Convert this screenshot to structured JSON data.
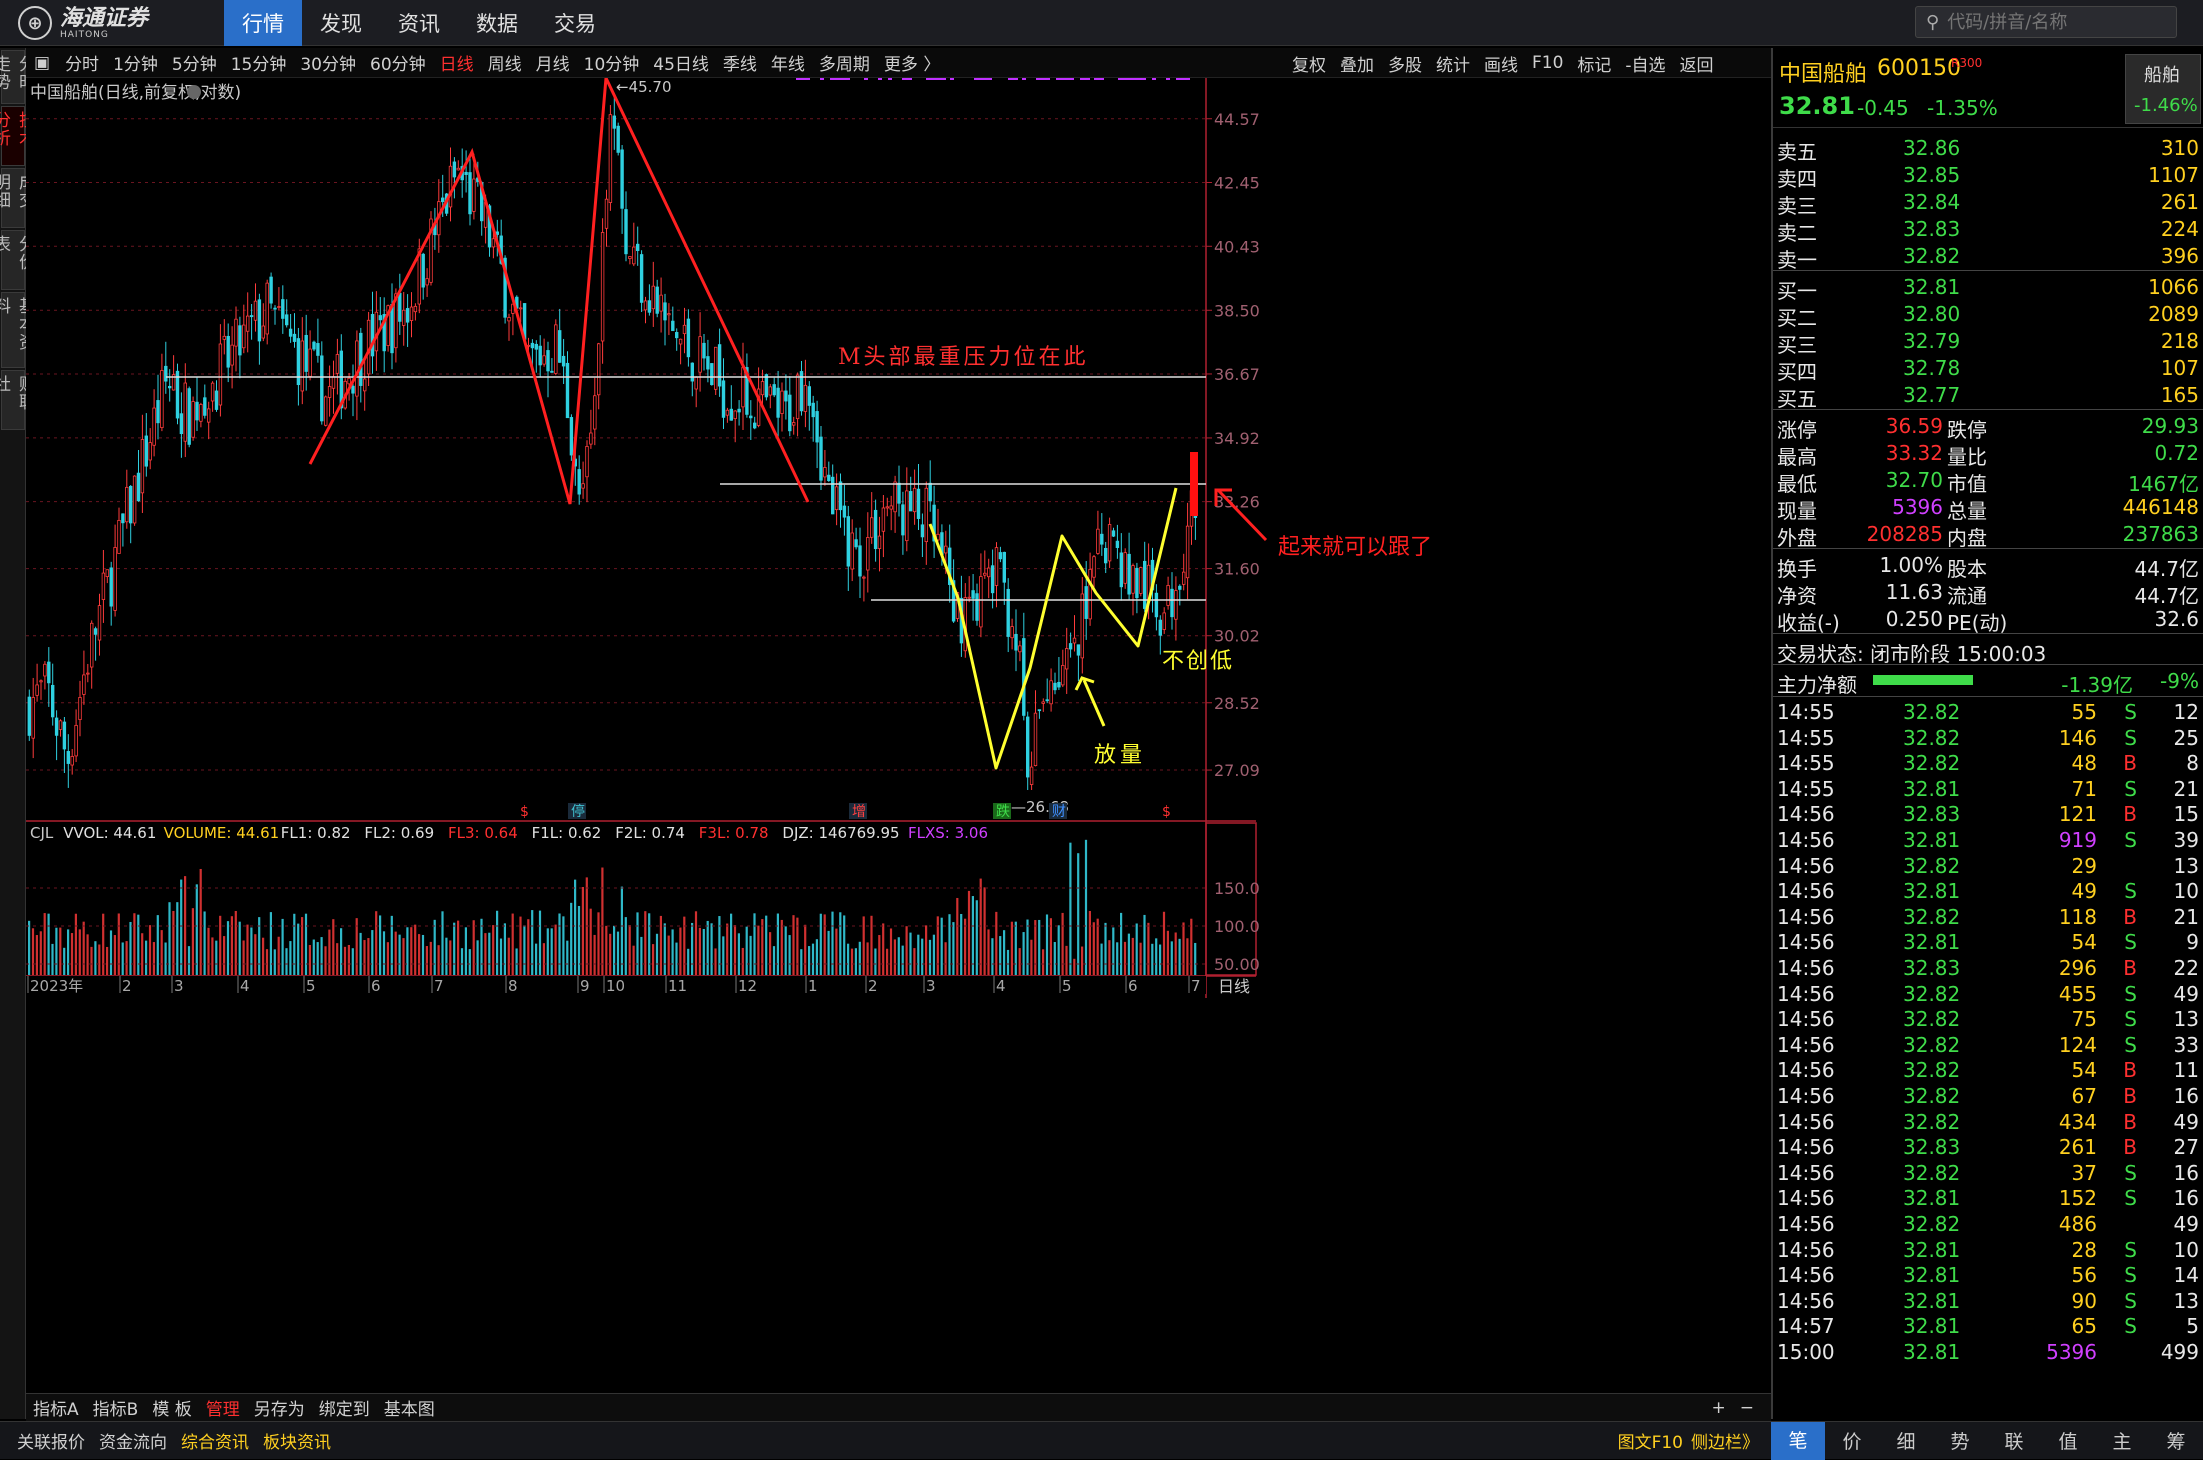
{
  "header": {
    "logo_cn": "海通证券",
    "logo_en": "HAITONG",
    "nav": [
      "行情",
      "发现",
      "资讯",
      "数据",
      "交易"
    ],
    "search_placeholder": "代码/拼音/名称"
  },
  "left_tabs": [
    "分时走势",
    "技术分析",
    "成交明细",
    "分价表",
    "基本资料",
    "财联社"
  ],
  "period_bar": [
    "分时",
    "1分钟",
    "5分钟",
    "15分钟",
    "30分钟",
    "60分钟",
    "日线",
    "周线",
    "月线",
    "10分钟",
    "45日线",
    "季线",
    "年线",
    "多周期",
    "更多 〉"
  ],
  "period_active": "日线",
  "right_tools": [
    "复权",
    "叠加",
    "多股",
    "统计",
    "画线",
    "F10",
    "标记",
    "-自选",
    "返回"
  ],
  "chart_label": "中国船舶(日线,前复权,对数)",
  "chart_data": {
    "type": "candlestick",
    "price_ticks": [
      "44.57",
      "42.45",
      "40.43",
      "38.50",
      "36.67",
      "34.92",
      "33.26",
      "31.60",
      "30.02",
      "28.52",
      "27.09"
    ],
    "max_label": "45.70",
    "min_label": "26.68",
    "xaxis": [
      "2023年",
      "2",
      "3",
      "4",
      "5",
      "6",
      "7",
      "8",
      "9",
      "10",
      "11",
      "12",
      "1",
      "2",
      "3",
      "4",
      "5",
      "6",
      "7"
    ],
    "event_markers": [
      "$",
      "停",
      "增",
      "跌",
      "财",
      "$"
    ],
    "volume_ticks": [
      "150.0",
      "100.0",
      "50.00"
    ],
    "volume_legend": [
      {
        "t": "CJL",
        "c": "#c8c8c8"
      },
      {
        "t": "VVOL: 44.61",
        "c": "#e0e0e0"
      },
      {
        "t": "VOLUME: 44.61",
        "c": "#ffd020"
      },
      {
        "t": "FL1: 0.82",
        "c": "#e0e0e0"
      },
      {
        "t": "FL2: 0.69",
        "c": "#e0e0e0"
      },
      {
        "t": "FL3: 0.64",
        "c": "#ff3030"
      },
      {
        "t": "F1L: 0.62",
        "c": "#e0e0e0"
      },
      {
        "t": "F2L: 0.74",
        "c": "#e0e0e0"
      },
      {
        "t": "F3L: 0.78",
        "c": "#ff3030"
      },
      {
        "t": "DJZ: 146769.95",
        "c": "#e0e0e0"
      },
      {
        "t": "FLXS: 3.06",
        "c": "#d040ff"
      }
    ],
    "period_label": "日线",
    "annotations": {
      "m_head": "M头部最重压力位在此",
      "volume_up": "放量",
      "no_new_low": "不创低",
      "chase": "起来就可以跟了"
    }
  },
  "bottom_bar": [
    "指标A",
    "指标B",
    "模 板",
    "管理",
    "另存为",
    "绑定到",
    "基本图"
  ],
  "status_bar": [
    "关联报价",
    "资金流向",
    "综合资讯",
    "板块资讯"
  ],
  "status_right": [
    "图文F10",
    "侧边栏》"
  ],
  "quote": {
    "name": "中国船舶",
    "code": "600150",
    "badge": "R300",
    "sector": "船舶",
    "sector_pct": "-1.46%",
    "price": "32.81",
    "change": "-0.45",
    "pct": "-1.35%",
    "asks": [
      [
        "卖五",
        "32.86",
        "310"
      ],
      [
        "卖四",
        "32.85",
        "1107"
      ],
      [
        "卖三",
        "32.84",
        "261"
      ],
      [
        "卖二",
        "32.83",
        "224"
      ],
      [
        "卖一",
        "32.82",
        "396"
      ]
    ],
    "bids": [
      [
        "买一",
        "32.81",
        "1066"
      ],
      [
        "买二",
        "32.80",
        "2089"
      ],
      [
        "买三",
        "32.79",
        "218"
      ],
      [
        "买四",
        "32.78",
        "107"
      ],
      [
        "买五",
        "32.77",
        "165"
      ]
    ],
    "stats": [
      [
        "涨停",
        "36.59",
        "跌停",
        "29.93"
      ],
      [
        "最高",
        "33.32",
        "量比",
        "0.72"
      ],
      [
        "最低",
        "32.70",
        "市值",
        "1467亿"
      ],
      [
        "现量",
        "5396",
        "总量",
        "446148"
      ],
      [
        "外盘",
        "208285",
        "内盘",
        "237863"
      ]
    ],
    "fund": [
      [
        "换手",
        "1.00%",
        "股本",
        "44.7亿"
      ],
      [
        "净资",
        "11.63",
        "流通",
        "44.7亿"
      ],
      [
        "收益(-)",
        "0.250",
        "PE(动)",
        "32.6"
      ]
    ],
    "trade_status": "交易状态: 闭市阶段 15:00:03",
    "main_flow_label": "主力净额",
    "main_flow": "-1.39亿",
    "main_pct": "-9%",
    "ticks": [
      [
        "14:55",
        "32.82",
        "55",
        "S",
        "12"
      ],
      [
        "14:55",
        "32.82",
        "146",
        "S",
        "25"
      ],
      [
        "14:55",
        "32.82",
        "48",
        "B",
        "8"
      ],
      [
        "14:55",
        "32.81",
        "71",
        "S",
        "21"
      ],
      [
        "14:56",
        "32.83",
        "121",
        "B",
        "15"
      ],
      [
        "14:56",
        "32.81",
        "919",
        "S",
        "39"
      ],
      [
        "14:56",
        "32.82",
        "29",
        "",
        "13"
      ],
      [
        "14:56",
        "32.81",
        "49",
        "S",
        "10"
      ],
      [
        "14:56",
        "32.82",
        "118",
        "B",
        "21"
      ],
      [
        "14:56",
        "32.81",
        "54",
        "S",
        "9"
      ],
      [
        "14:56",
        "32.83",
        "296",
        "B",
        "22"
      ],
      [
        "14:56",
        "32.82",
        "455",
        "S",
        "49"
      ],
      [
        "14:56",
        "32.82",
        "75",
        "S",
        "13"
      ],
      [
        "14:56",
        "32.82",
        "124",
        "S",
        "33"
      ],
      [
        "14:56",
        "32.82",
        "54",
        "B",
        "11"
      ],
      [
        "14:56",
        "32.82",
        "67",
        "B",
        "16"
      ],
      [
        "14:56",
        "32.82",
        "434",
        "B",
        "49"
      ],
      [
        "14:56",
        "32.83",
        "261",
        "B",
        "27"
      ],
      [
        "14:56",
        "32.82",
        "37",
        "S",
        "16"
      ],
      [
        "14:56",
        "32.81",
        "152",
        "S",
        "16"
      ],
      [
        "14:56",
        "32.82",
        "486",
        "",
        "49"
      ],
      [
        "14:56",
        "32.81",
        "28",
        "S",
        "10"
      ],
      [
        "14:56",
        "32.81",
        "56",
        "S",
        "14"
      ],
      [
        "14:56",
        "32.81",
        "90",
        "S",
        "13"
      ],
      [
        "14:57",
        "32.81",
        "65",
        "S",
        "5"
      ],
      [
        "15:00",
        "32.81",
        "5396",
        "",
        "499"
      ]
    ],
    "tabs": [
      "笔",
      "价",
      "细",
      "势",
      "联",
      "值",
      "主",
      "筹"
    ]
  }
}
